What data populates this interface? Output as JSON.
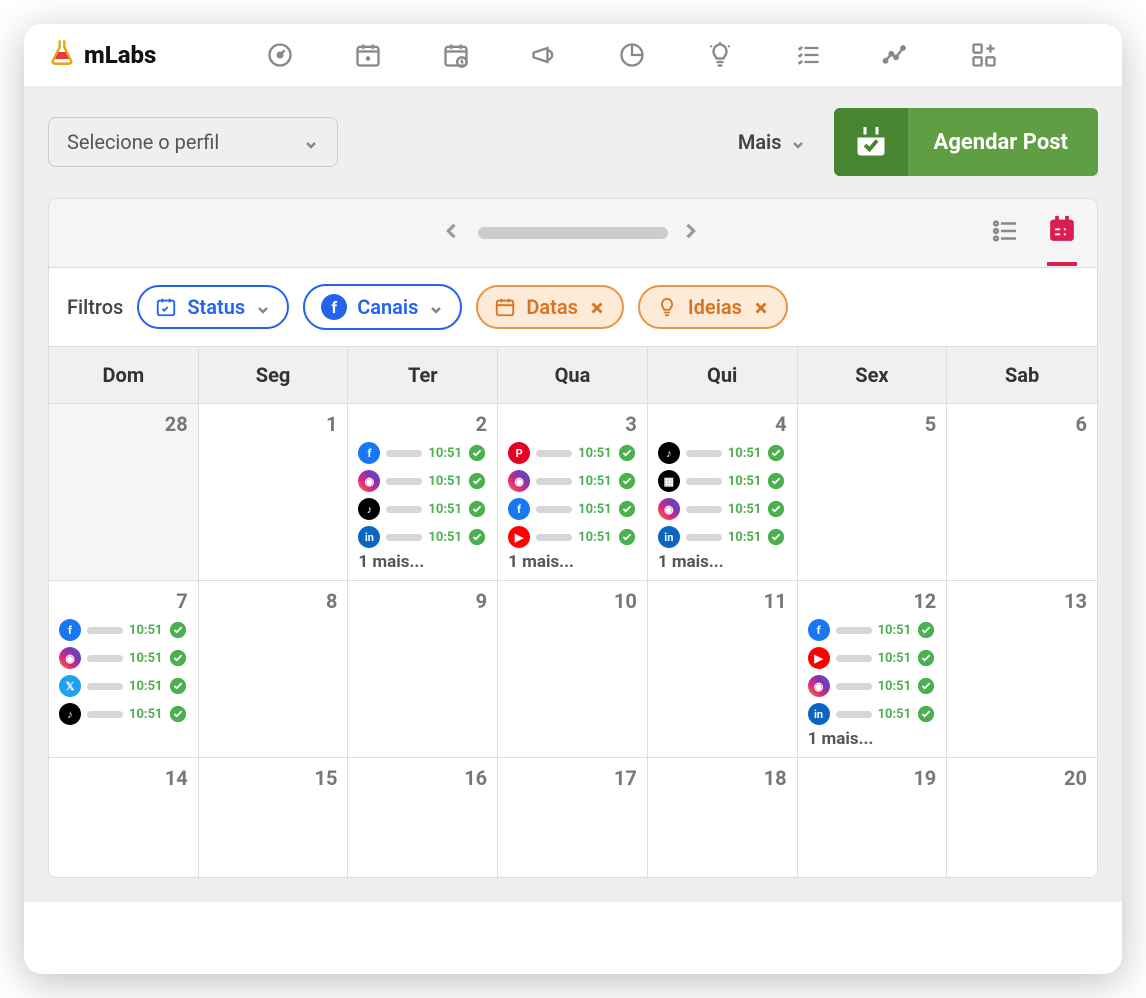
{
  "brand": "mLabs",
  "profile_select_placeholder": "Selecione o perfil",
  "mais_label": "Mais",
  "agendar_label": "Agendar Post",
  "filters_label": "Filtros",
  "pills": {
    "status": "Status",
    "canais": "Canais",
    "datas": "Datas",
    "ideias": "Ideias"
  },
  "weekdays": [
    "Dom",
    "Seg",
    "Ter",
    "Qua",
    "Qui",
    "Sex",
    "Sab"
  ],
  "more_label": "1 mais...",
  "cells": [
    {
      "day": "28",
      "muted": true,
      "posts": []
    },
    {
      "day": "1",
      "muted": false,
      "posts": []
    },
    {
      "day": "2",
      "muted": false,
      "posts": [
        {
          "net": "facebook",
          "time": "10:51"
        },
        {
          "net": "instagram",
          "time": "10:51"
        },
        {
          "net": "tiktok",
          "time": "10:51"
        },
        {
          "net": "linkedin",
          "time": "10:51"
        }
      ],
      "more": true
    },
    {
      "day": "3",
      "muted": false,
      "posts": [
        {
          "net": "pinterest",
          "time": "10:51"
        },
        {
          "net": "instagram",
          "time": "10:51"
        },
        {
          "net": "facebook",
          "time": "10:51"
        },
        {
          "net": "youtube",
          "time": "10:51"
        }
      ],
      "more": true
    },
    {
      "day": "4",
      "muted": false,
      "posts": [
        {
          "net": "tiktok",
          "time": "10:51"
        },
        {
          "net": "reels",
          "time": "10:51"
        },
        {
          "net": "instagram",
          "time": "10:51"
        },
        {
          "net": "linkedin",
          "time": "10:51"
        }
      ],
      "more": true
    },
    {
      "day": "5",
      "muted": false,
      "posts": []
    },
    {
      "day": "6",
      "muted": false,
      "posts": []
    },
    {
      "day": "7",
      "muted": false,
      "posts": [
        {
          "net": "facebook",
          "time": "10:51"
        },
        {
          "net": "instagram",
          "time": "10:51"
        },
        {
          "net": "twitter",
          "time": "10:51"
        },
        {
          "net": "tiktok",
          "time": "10:51"
        }
      ]
    },
    {
      "day": "8",
      "muted": false,
      "posts": []
    },
    {
      "day": "9",
      "muted": false,
      "posts": []
    },
    {
      "day": "10",
      "muted": false,
      "posts": []
    },
    {
      "day": "11",
      "muted": false,
      "posts": []
    },
    {
      "day": "12",
      "muted": false,
      "posts": [
        {
          "net": "facebook",
          "time": "10:51"
        },
        {
          "net": "youtube",
          "time": "10:51"
        },
        {
          "net": "instagram",
          "time": "10:51"
        },
        {
          "net": "linkedin",
          "time": "10:51"
        }
      ],
      "more": true
    },
    {
      "day": "13",
      "muted": false,
      "posts": []
    },
    {
      "day": "14",
      "muted": false,
      "posts": []
    },
    {
      "day": "15",
      "muted": false,
      "posts": []
    },
    {
      "day": "16",
      "muted": false,
      "posts": []
    },
    {
      "day": "17",
      "muted": false,
      "posts": []
    },
    {
      "day": "18",
      "muted": false,
      "posts": []
    },
    {
      "day": "19",
      "muted": false,
      "posts": []
    },
    {
      "day": "20",
      "muted": false,
      "posts": []
    }
  ]
}
